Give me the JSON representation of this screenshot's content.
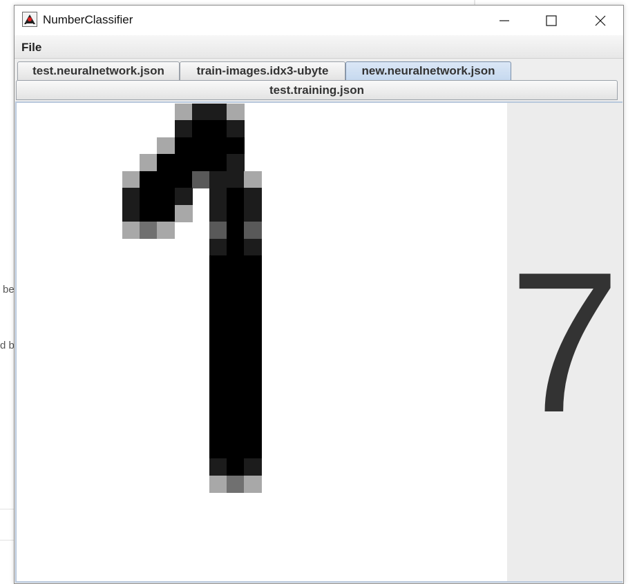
{
  "window": {
    "title": "NumberClassifier",
    "app_icon": "java-duke-icon",
    "controls": [
      "minimize-icon",
      "maximize-icon",
      "close-icon"
    ]
  },
  "menu": {
    "items": [
      {
        "label": "File"
      }
    ]
  },
  "tabs": {
    "row1": [
      {
        "label": "test.neuralnetwork.json",
        "selected": false
      },
      {
        "label": "train-images.idx3-ubyte",
        "selected": false
      },
      {
        "label": "new.neuralnetwork.json",
        "selected": true
      }
    ],
    "row2": [
      {
        "label": "test.training.json",
        "selected": false
      }
    ]
  },
  "classifier": {
    "prediction": "7",
    "image_rows": 28,
    "image_cols": 28
  },
  "background": {
    "fragment_1": "be",
    "fragment_2": "d b"
  }
}
